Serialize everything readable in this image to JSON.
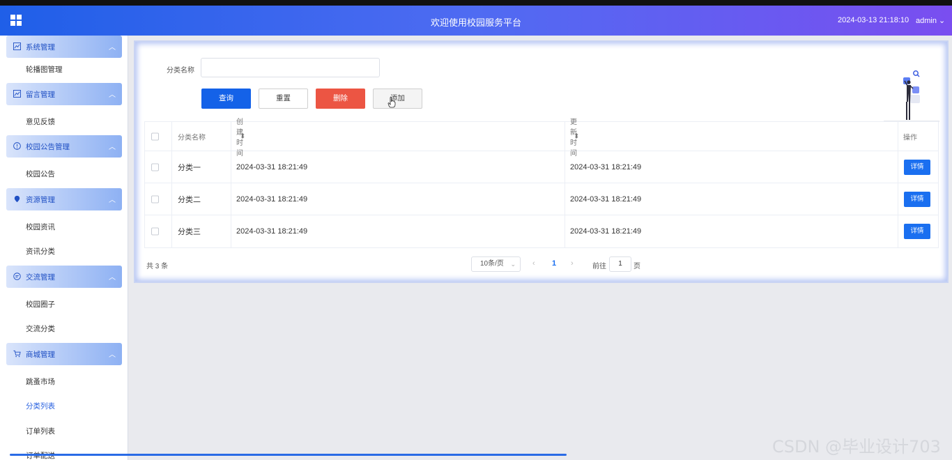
{
  "header": {
    "title": "欢迎使用校园服务平台",
    "datetime": "2024-03-13 21:18:10",
    "user": "admin"
  },
  "sidebar": {
    "groups": [
      {
        "label": "系统管理",
        "icon": "image-icon",
        "items": [
          "轮播图管理"
        ]
      },
      {
        "label": "留言管理",
        "icon": "image-icon",
        "items": [
          "意见反馈"
        ]
      },
      {
        "label": "校园公告管理",
        "icon": "info-circle-icon",
        "items": [
          "校园公告"
        ]
      },
      {
        "label": "资源管理",
        "icon": "location-pin-icon",
        "items": [
          "校园资讯",
          "资讯分类"
        ]
      },
      {
        "label": "交流管理",
        "icon": "chat-bubble-icon",
        "items": [
          "校园圈子",
          "交流分类"
        ]
      },
      {
        "label": "商城管理",
        "icon": "cart-icon",
        "items": [
          "跳蚤市场",
          "分类列表",
          "订单列表",
          "订单配送"
        ]
      }
    ],
    "active_item": "分类列表"
  },
  "search": {
    "label": "分类名称",
    "value": "",
    "placeholder": ""
  },
  "buttons": {
    "query": "查询",
    "reset": "重置",
    "delete": "删除",
    "add": "添加"
  },
  "table": {
    "columns": [
      "分类名称",
      "创建时间",
      "更新时间",
      "操作"
    ],
    "rows": [
      {
        "name": "分类一",
        "created": "2024-03-31 18:21:49",
        "updated": "2024-03-31 18:21:49",
        "action": "详情"
      },
      {
        "name": "分类二",
        "created": "2024-03-31 18:21:49",
        "updated": "2024-03-31 18:21:49",
        "action": "详情"
      },
      {
        "name": "分类三",
        "created": "2024-03-31 18:21:49",
        "updated": "2024-03-31 18:21:49",
        "action": "详情"
      }
    ]
  },
  "pagination": {
    "total": "共 3 条",
    "page_size": "10条/页",
    "current_page": "1",
    "goto_label": "前往",
    "goto_value": "1",
    "page_suffix": "页"
  },
  "watermark": "CSDN @毕业设计703",
  "colors": {
    "primary": "#1462e8",
    "danger": "#ec5543",
    "header_start": "#1f5fe8",
    "header_end": "#7a4ef0"
  }
}
